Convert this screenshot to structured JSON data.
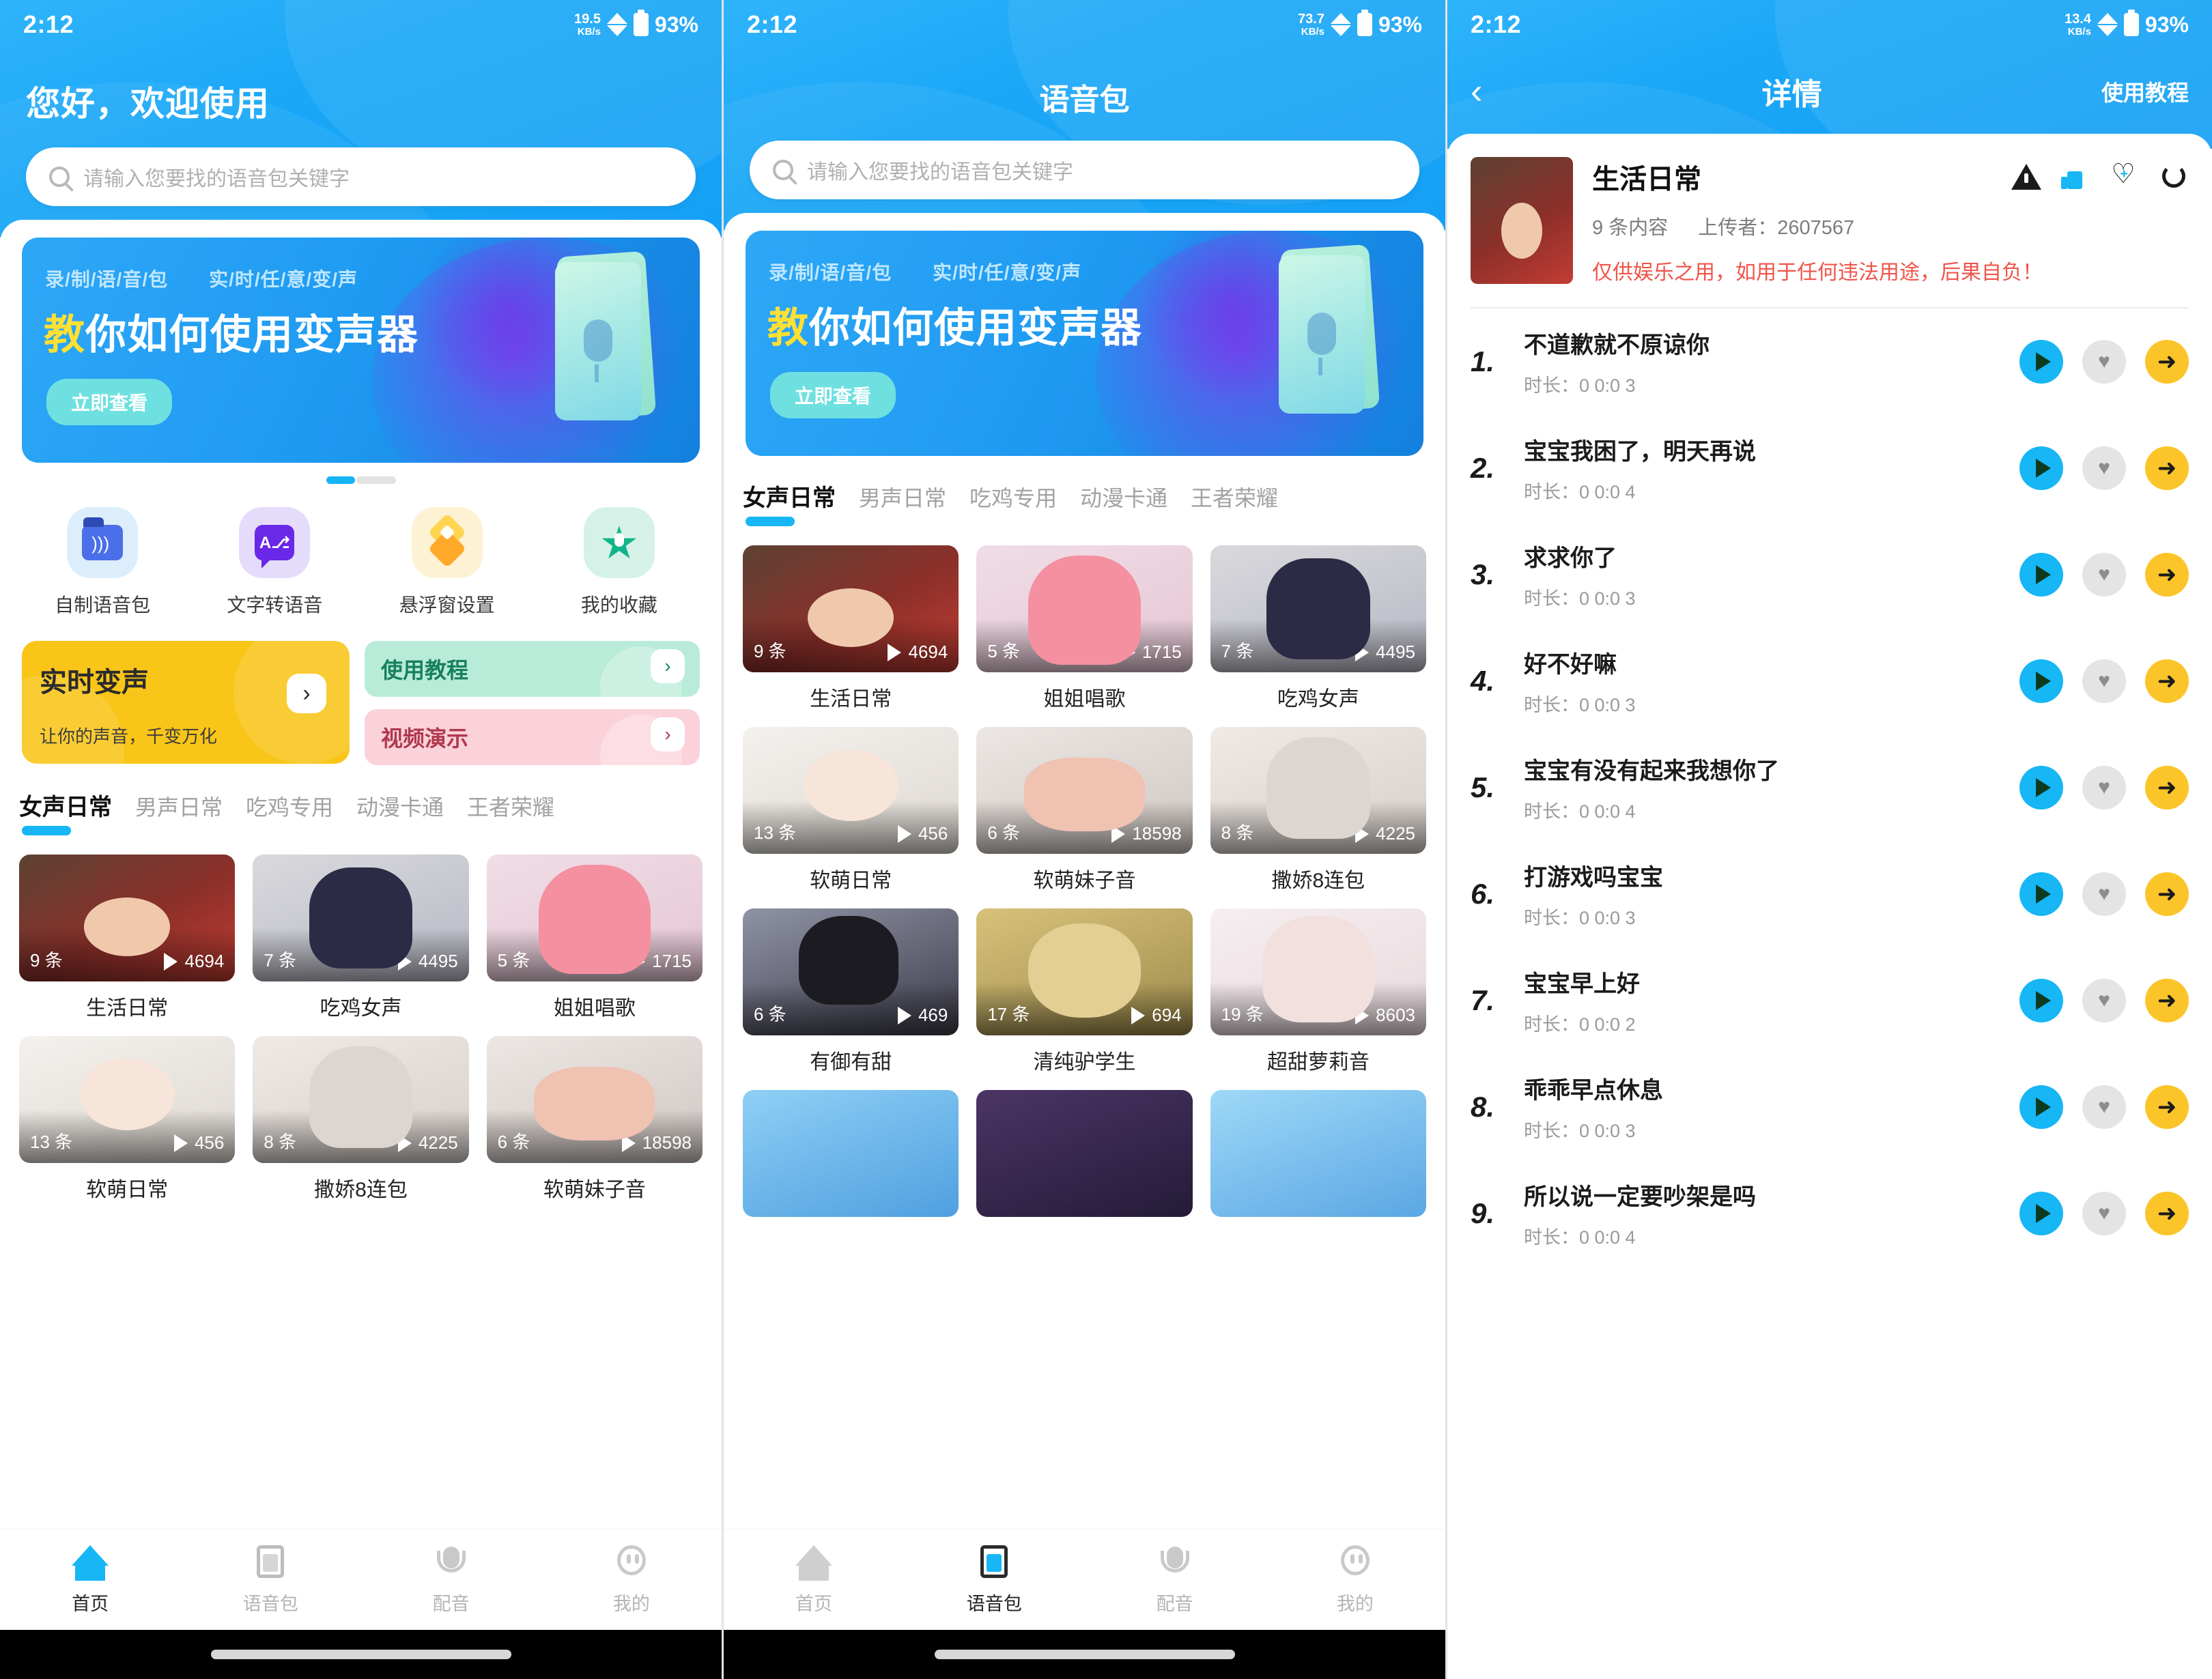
{
  "status": {
    "time": "2:12",
    "battery": "93%",
    "net1": "19.5",
    "net2": "73.7",
    "net3": "13.4",
    "net_unit": "KB/s"
  },
  "panel1": {
    "greeting": "您好，欢迎使用",
    "search_placeholder": "请输入您要找的语音包关键字",
    "banner": {
      "tagline_left": "录/制/语/音/包",
      "tagline_right": "实/时/任/意/变/声",
      "headline_a": "教",
      "headline_b": "你如何使用变声器",
      "button": "立即查看"
    },
    "quick": [
      {
        "label": "自制语音包",
        "icon": "folder-wave-icon"
      },
      {
        "label": "文字转语音",
        "icon": "text-to-speech-icon"
      },
      {
        "label": "悬浮窗设置",
        "icon": "floating-window-icon"
      },
      {
        "label": "我的收藏",
        "icon": "star-favorite-icon"
      }
    ],
    "promo_big": {
      "title": "实时变声",
      "subtitle": "让你的声音，千变万化"
    },
    "promo_small": [
      {
        "title": "使用教程"
      },
      {
        "title": "视频演示"
      }
    ],
    "tabs": [
      "女声日常",
      "男声日常",
      "吃鸡专用",
      "动漫卡通",
      "王者荣耀"
    ],
    "active_tab": 0,
    "cards": [
      {
        "count": "9 条",
        "plays": "4694",
        "name": "生活日常"
      },
      {
        "count": "7 条",
        "plays": "4495",
        "name": "吃鸡女声"
      },
      {
        "count": "5 条",
        "plays": "1715",
        "name": "姐姐唱歌"
      },
      {
        "count": "13 条",
        "plays": "456",
        "name": "软萌日常"
      },
      {
        "count": "8 条",
        "plays": "4225",
        "name": "撒娇8连包"
      },
      {
        "count": "6 条",
        "plays": "18598",
        "name": "软萌妹子音"
      }
    ],
    "tabbar": [
      {
        "label": "首页",
        "icon": "home-icon",
        "active": true
      },
      {
        "label": "语音包",
        "icon": "voice-pack-icon",
        "active": false
      },
      {
        "label": "配音",
        "icon": "mic-dub-icon",
        "active": false
      },
      {
        "label": "我的",
        "icon": "profile-icon",
        "active": false
      }
    ]
  },
  "panel2": {
    "title": "语音包",
    "search_placeholder": "请输入您要找的语音包关键字",
    "banner": {
      "tagline_left": "录/制/语/音/包",
      "tagline_right": "实/时/任/意/变/声",
      "headline_a": "教",
      "headline_b": "你如何使用变声器",
      "button": "立即查看"
    },
    "tabs": [
      "女声日常",
      "男声日常",
      "吃鸡专用",
      "动漫卡通",
      "王者荣耀"
    ],
    "active_tab": 0,
    "cards": [
      {
        "count": "9 条",
        "plays": "4694",
        "name": "生活日常"
      },
      {
        "count": "5 条",
        "plays": "1715",
        "name": "姐姐唱歌"
      },
      {
        "count": "7 条",
        "plays": "4495",
        "name": "吃鸡女声"
      },
      {
        "count": "13 条",
        "plays": "456",
        "name": "软萌日常"
      },
      {
        "count": "6 条",
        "plays": "18598",
        "name": "软萌妹子音"
      },
      {
        "count": "8 条",
        "plays": "4225",
        "name": "撒娇8连包"
      },
      {
        "count": "6 条",
        "plays": "469",
        "name": "有御有甜"
      },
      {
        "count": "17 条",
        "plays": "694",
        "name": "清纯驴学生"
      },
      {
        "count": "19 条",
        "plays": "8603",
        "name": "超甜萝莉音"
      }
    ],
    "tabbar": [
      {
        "label": "首页",
        "icon": "home-icon",
        "active": false
      },
      {
        "label": "语音包",
        "icon": "voice-pack-icon",
        "active": true
      },
      {
        "label": "配音",
        "icon": "mic-dub-icon",
        "active": false
      },
      {
        "label": "我的",
        "icon": "profile-icon",
        "active": false
      }
    ]
  },
  "panel3": {
    "nav_title": "详情",
    "nav_right": "使用教程",
    "back_icon": "back-chevron-icon",
    "detail": {
      "title": "生活日常",
      "count_text": "9 条内容",
      "uploader_text": "上传者：2607567",
      "warning": "仅供娱乐之用，如用于任何违法用途，后果自负！",
      "actions": [
        {
          "icon": "report-warning-icon"
        },
        {
          "icon": "thumbs-up-icon"
        },
        {
          "icon": "heart-add-icon"
        },
        {
          "icon": "refresh-icon"
        }
      ]
    },
    "duration_prefix": "时长：",
    "items": [
      {
        "index": "1.",
        "name": "不道歉就不原谅你",
        "duration": "0 0:0 3"
      },
      {
        "index": "2.",
        "name": "宝宝我困了，明天再说",
        "duration": "0 0:0 4"
      },
      {
        "index": "3.",
        "name": "求求你了",
        "duration": "0 0:0 3"
      },
      {
        "index": "4.",
        "name": "好不好嘛",
        "duration": "0 0:0 3"
      },
      {
        "index": "5.",
        "name": "宝宝有没有起来我想你了",
        "duration": "0 0:0 4"
      },
      {
        "index": "6.",
        "name": "打游戏吗宝宝",
        "duration": "0 0:0 3"
      },
      {
        "index": "7.",
        "name": "宝宝早上好",
        "duration": "0 0:0 2"
      },
      {
        "index": "8.",
        "name": "乖乖早点休息",
        "duration": "0 0:0 3"
      },
      {
        "index": "9.",
        "name": "所以说一定要吵架是吗",
        "duration": "0 0:0 4"
      }
    ],
    "row_buttons": [
      {
        "icon": "play-icon"
      },
      {
        "icon": "favorite-heart-icon"
      },
      {
        "icon": "share-arrow-icon"
      }
    ]
  },
  "colors": {
    "brand_blue": "#17b6f5",
    "accent_yellow": "#f9c518",
    "warn_red": "#f0544a",
    "share_yellow": "#fbc52a"
  }
}
